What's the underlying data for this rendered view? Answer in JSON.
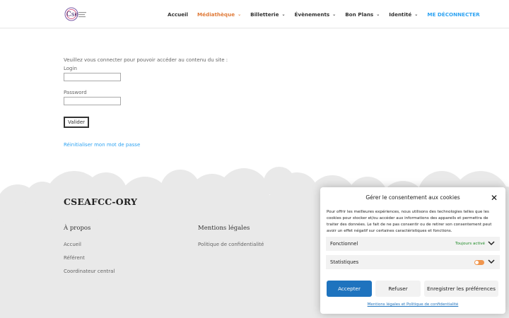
{
  "header": {
    "logo_text": "Cse",
    "nav": [
      {
        "label": "Accueil",
        "dropdown": false,
        "state": "normal"
      },
      {
        "label": "Médiathèque",
        "dropdown": true,
        "state": "active"
      },
      {
        "label": "Billetterie",
        "dropdown": true,
        "state": "normal"
      },
      {
        "label": "Évènements",
        "dropdown": true,
        "state": "normal"
      },
      {
        "label": "Bon Plans",
        "dropdown": true,
        "state": "normal"
      },
      {
        "label": "Identité",
        "dropdown": true,
        "state": "normal"
      },
      {
        "label": "ME DÉCONNECTER",
        "dropdown": false,
        "state": "accent"
      }
    ]
  },
  "login": {
    "intro": "Veuillez vous connecter pour pouvoir accéder au contenu du site :",
    "login_label": "Login",
    "login_value": "",
    "password_label": "Password",
    "password_value": "",
    "submit_label": "Valider",
    "reset_label": "Réinitialiser mon mot de passe"
  },
  "footer": {
    "brand": "CSEAFCC-ORY",
    "about_title": "À propos",
    "about_links": [
      "Accueil",
      "Référent",
      "Coordinateur central"
    ],
    "legal_title": "Mentions légales",
    "legal_links": [
      "Politique de confidentialité"
    ]
  },
  "cookie": {
    "title": "Gérer le consentement aux cookies",
    "text": "Pour offrir les meilleures expériences, nous utilisons des technologies telles que les cookies pour stocker et/ou accéder aux informations des appareils et permettra de traiter des données. Le fait de ne pas consentir ou de retirer son consentement peut avoir un effet négatif sur certaines caractéristiques et fonctions.",
    "categories": [
      {
        "name": "Fonctionnel",
        "status": "Toujours activé"
      },
      {
        "name": "Statistiques",
        "status": ""
      }
    ],
    "accept_label": "Accepter",
    "refuse_label": "Refuser",
    "save_label": "Enregistrer les préférences",
    "footer_link": "Mentions légales et Politique de confidentialité"
  },
  "colors": {
    "accent": "#2ea3f2",
    "active": "#e07b39",
    "primary_button": "#1e73be",
    "toggle": "#f0954d",
    "footer_bg": "#e9e9e9"
  }
}
